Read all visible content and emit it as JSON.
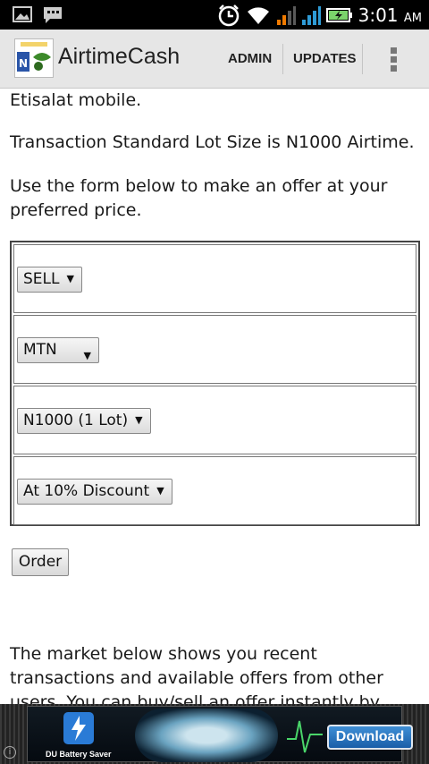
{
  "status_bar": {
    "time": "3:01",
    "ampm": "AM",
    "left_icons": [
      "image-icon",
      "chat-icon"
    ],
    "right_icons": [
      "alarm-icon",
      "wifi-icon",
      "signal-orange-icon",
      "signal-blue-icon",
      "battery-charging-icon"
    ]
  },
  "action_bar": {
    "title": "AirtimeCash",
    "admin_label": "ADMIN",
    "updates_label": "UPDATES",
    "logo_text": "AIRTIMECash"
  },
  "content": {
    "para_1": "Etisalat mobile.",
    "para_2": "Transaction Standard Lot Size is N1000 Airtime.",
    "para_3": "Use the form below to make an offer at your preferred price.",
    "form": {
      "action_select": "SELL",
      "network_select": "MTN",
      "amount_select": "N1000 (1 Lot)",
      "price_select": "At 10% Discount"
    },
    "order_button": "Order",
    "para_4": "The market below shows you recent transactions and available offers from other users. You can buy/sell an offer instantly by clicking the link to the"
  },
  "ad": {
    "label": "DU Battery Saver",
    "download_label": "Download",
    "info": "i"
  },
  "colors": {
    "status_bar_bg": "#000000",
    "action_bar_bg": "#e6e6e6",
    "signal_orange": "#f07a00",
    "signal_blue": "#2e9bd6",
    "battery_green": "#7bd36b",
    "ad_button": "#2a78c8"
  }
}
